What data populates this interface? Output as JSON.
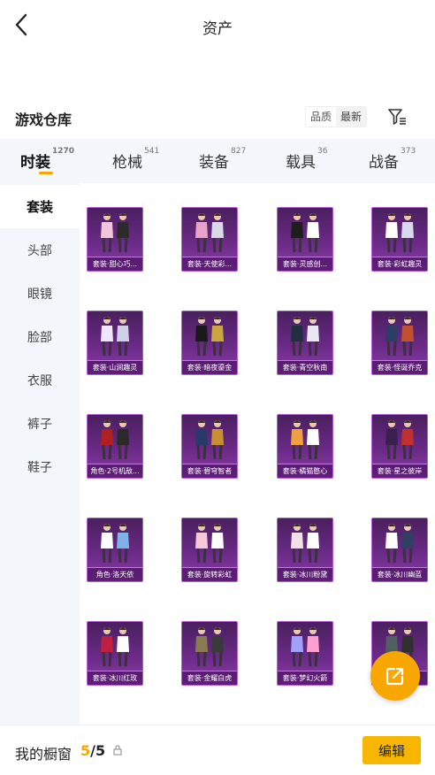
{
  "header": {
    "title": "资产"
  },
  "warehouse": {
    "title": "游戏仓库",
    "sort_quality": "品质",
    "sort_latest": "最新"
  },
  "tabs": [
    {
      "label": "时装",
      "count": "1270"
    },
    {
      "label": "枪械",
      "count": "541"
    },
    {
      "label": "装备",
      "count": "827"
    },
    {
      "label": "载具",
      "count": "36"
    },
    {
      "label": "战备",
      "count": "373"
    }
  ],
  "sidebar": [
    {
      "label": "套装"
    },
    {
      "label": "头部"
    },
    {
      "label": "眼镜"
    },
    {
      "label": "脸部"
    },
    {
      "label": "衣服"
    },
    {
      "label": "裤子"
    },
    {
      "label": "鞋子"
    }
  ],
  "items": [
    {
      "label": "套装·甜心巧..."
    },
    {
      "label": "套装·天使彩..."
    },
    {
      "label": "套装·灵感创..."
    },
    {
      "label": "套装·彩虹趣灵"
    },
    {
      "label": "套装·山涧趣灵"
    },
    {
      "label": "套装·暗夜鎏金"
    },
    {
      "label": "套装·青空秋南"
    },
    {
      "label": "套装·怪诞乔克"
    },
    {
      "label": "角色·2号机敌..."
    },
    {
      "label": "套装·碧穹智者"
    },
    {
      "label": "套装·橘猫憨心"
    },
    {
      "label": "套装·星之彼岸"
    },
    {
      "label": "角色·洛天依"
    },
    {
      "label": "套装·旋转彩虹"
    },
    {
      "label": "套装·冰川粉黛"
    },
    {
      "label": "套装·冰川幽蓝"
    },
    {
      "label": "套装·冰川红玫"
    },
    {
      "label": "套装·金耀白虎"
    },
    {
      "label": "套装·梦幻火箭"
    },
    {
      "label": "套装·..."
    }
  ],
  "showcase": {
    "label": "我的橱窗",
    "current": "5",
    "separator": "/",
    "total": "5"
  },
  "edit_button": "编辑",
  "colors": {
    "accent": "#f7b600",
    "card_bg": "#6a2a86",
    "card_border": "#b45fd4"
  }
}
